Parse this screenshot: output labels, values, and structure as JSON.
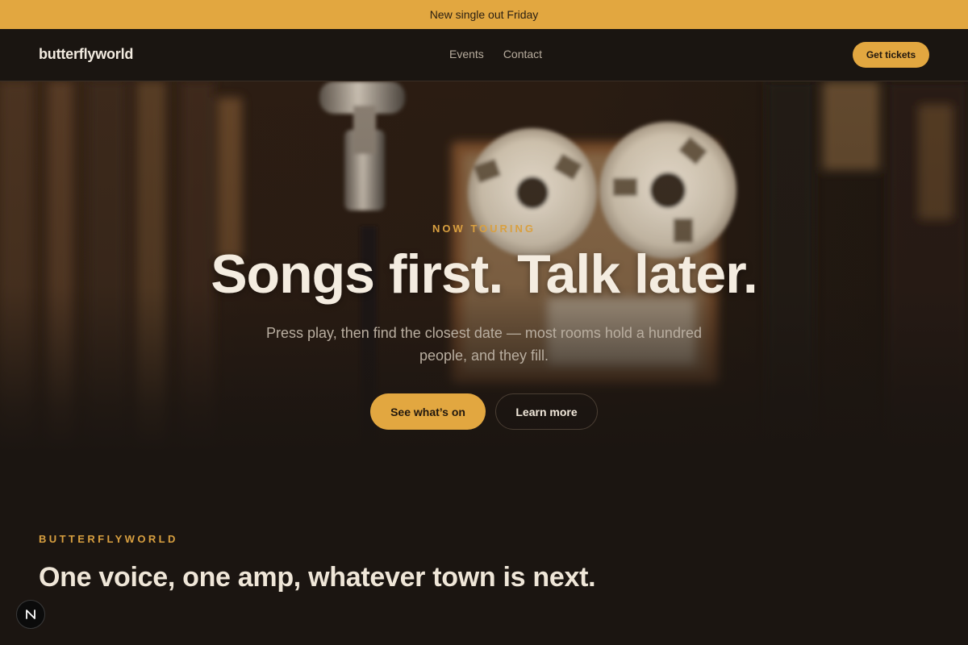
{
  "banner": {
    "text": "New single out Friday"
  },
  "nav": {
    "logo": "butterflyworld",
    "links": [
      {
        "label": "Events"
      },
      {
        "label": "Contact"
      }
    ],
    "cta_label": "Get tickets"
  },
  "hero": {
    "eyebrow": "NOW TOURING",
    "title": "Songs first. Talk later.",
    "subtitle": "Press play, then find the closest date — most rooms hold a hundred people, and they fill.",
    "primary_label": "See what’s on",
    "secondary_label": "Learn more",
    "image_icon": "studio-microphone-reel-to-reel-photo"
  },
  "about": {
    "eyebrow": "BUTTERFLYWORLD",
    "title": "One voice, one amp, whatever town is next."
  },
  "badge": {
    "icon": "nextjs-n-icon"
  },
  "colors": {
    "accent": "#e2a740",
    "background": "#1b1511",
    "text": "#efe6d8"
  }
}
